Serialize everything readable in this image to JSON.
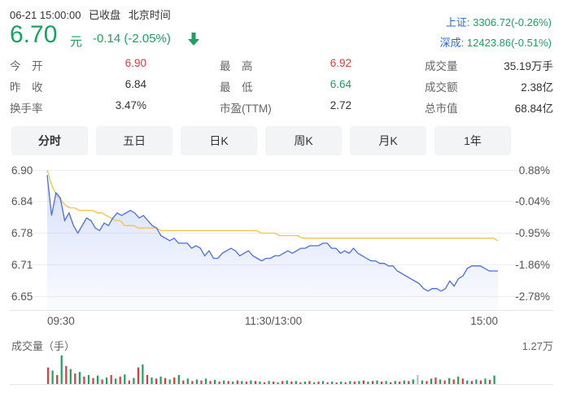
{
  "header": {
    "date": "06-21 15:00:00",
    "status": "已收盘",
    "timezone": "北京时间"
  },
  "quote": {
    "price": "6.70",
    "unit": "元",
    "change": "-0.14 (-2.05%)"
  },
  "indices": [
    {
      "label": "上证:",
      "value": "3306.72(-0.26%)"
    },
    {
      "label": "深成:",
      "value": "12423.86(-0.51%)"
    }
  ],
  "stats": {
    "open_label": "今　开",
    "open": "6.90",
    "high_label": "最　高",
    "high": "6.92",
    "volume_label": "成交量",
    "volume": "35.19万手",
    "prev_label": "昨　收",
    "prev": "6.84",
    "low_label": "最　低",
    "low": "6.64",
    "amount_label": "成交额",
    "amount": "2.38亿",
    "turnover_label": "换手率",
    "turnover": "3.47%",
    "pe_label": "市盈(TTM)",
    "pe": "2.72",
    "mcap_label": "总市值",
    "mcap": "68.84亿"
  },
  "tabs": [
    "分时",
    "五日",
    "日K",
    "周K",
    "月K",
    "1年"
  ],
  "colors": {
    "up": "#e8353a",
    "down": "#1aa261",
    "price_line": "#4a6de5",
    "avg_line": "#f5c24a",
    "index_label": "#2a6ad7"
  },
  "chart_data": {
    "type": "line",
    "price_ticks": [
      "6.90",
      "6.84",
      "6.78",
      "6.71",
      "6.65"
    ],
    "pct_ticks": [
      "0.88%",
      "-0.04%",
      "-0.95%",
      "-1.86%",
      "-2.78%"
    ],
    "time_ticks": [
      "09:30",
      "11:30/13:00",
      "15:00"
    ],
    "ylim": [
      6.65,
      6.9
    ],
    "volume_label": "成交量（手）",
    "volume_max": "1.27万",
    "series": [
      {
        "values": [
          6.89,
          6.81,
          6.855,
          6.845,
          6.8,
          6.815,
          6.79,
          6.775,
          6.79,
          6.805,
          6.8,
          6.785,
          6.78,
          6.795,
          6.79,
          6.805,
          6.815,
          6.81,
          6.815,
          6.82,
          6.815,
          6.805,
          6.81,
          6.8,
          6.79,
          6.785,
          6.77,
          6.765,
          6.76,
          6.765,
          6.755,
          6.755,
          6.755,
          6.745,
          6.75,
          6.745,
          6.73,
          6.74,
          6.725,
          6.725,
          6.735,
          6.74,
          6.745,
          6.74,
          6.73,
          6.735,
          6.74,
          6.73,
          6.725,
          6.72,
          6.725,
          6.725,
          6.73,
          6.73,
          6.735,
          6.74,
          6.735,
          6.74,
          6.745,
          6.745,
          6.75,
          6.75,
          6.75,
          6.755,
          6.755,
          6.745,
          6.745,
          6.735,
          6.74,
          6.735,
          6.745,
          6.735,
          6.73,
          6.725,
          6.72,
          6.72,
          6.715,
          6.715,
          6.71,
          6.71,
          6.7,
          6.695,
          6.69,
          6.685,
          6.68,
          6.675,
          6.665,
          6.66,
          6.665,
          6.665,
          6.66,
          6.665,
          6.68,
          6.67,
          6.685,
          6.69,
          6.705,
          6.71,
          6.71,
          6.71,
          6.705,
          6.7,
          6.7,
          6.7
        ]
      },
      {
        "values": [
          6.9,
          6.87,
          6.85,
          6.84,
          6.83,
          6.825,
          6.825,
          6.82,
          6.82,
          6.82,
          6.82,
          6.815,
          6.815,
          6.81,
          6.805,
          6.8,
          6.8,
          6.79,
          6.79,
          6.79,
          6.785,
          6.785,
          6.785,
          6.785,
          6.785,
          6.78,
          6.78,
          6.78,
          6.78,
          6.78,
          6.78,
          6.78,
          6.78,
          6.78,
          6.78,
          6.78,
          6.78,
          6.78,
          6.78,
          6.78,
          6.78,
          6.78,
          6.78,
          6.78,
          6.78,
          6.78,
          6.78,
          6.775,
          6.775,
          6.775,
          6.775,
          6.77,
          6.77,
          6.77,
          6.77,
          6.77,
          6.765,
          6.765,
          6.765,
          6.765,
          6.765,
          6.765,
          6.765,
          6.765,
          6.765,
          6.765,
          6.765,
          6.765,
          6.765,
          6.765,
          6.765,
          6.765,
          6.765,
          6.765,
          6.765,
          6.765,
          6.765,
          6.765,
          6.765,
          6.765,
          6.765,
          6.765,
          6.765,
          6.765,
          6.765,
          6.765,
          6.765,
          6.765,
          6.765,
          6.765,
          6.765,
          6.765,
          6.765,
          6.765,
          6.765,
          6.765,
          6.765,
          6.765,
          6.765,
          6.76
        ]
      }
    ],
    "volumes": [
      {
        "v": 0.55,
        "c": "up"
      },
      {
        "v": 0.45,
        "c": "down"
      },
      {
        "v": 0.3,
        "c": "up"
      },
      {
        "v": 0.95,
        "c": "down"
      },
      {
        "v": 0.6,
        "c": "up"
      },
      {
        "v": 0.5,
        "c": "down"
      },
      {
        "v": 0.35,
        "c": "up"
      },
      {
        "v": 0.4,
        "c": "down"
      },
      {
        "v": 0.25,
        "c": "up"
      },
      {
        "v": 0.3,
        "c": "down"
      },
      {
        "v": 0.2,
        "c": "up"
      },
      {
        "v": 0.28,
        "c": "down"
      },
      {
        "v": 0.15,
        "c": "up"
      },
      {
        "v": 0.22,
        "c": "down"
      },
      {
        "v": 0.3,
        "c": "up"
      },
      {
        "v": 0.18,
        "c": "down"
      },
      {
        "v": 0.25,
        "c": "up"
      },
      {
        "v": 0.32,
        "c": "down"
      },
      {
        "v": 0.12,
        "c": "up"
      },
      {
        "v": 0.2,
        "c": "down"
      },
      {
        "v": 0.55,
        "c": "up"
      },
      {
        "v": 0.65,
        "c": "down"
      },
      {
        "v": 0.3,
        "c": "up"
      },
      {
        "v": 0.22,
        "c": "down"
      },
      {
        "v": 0.18,
        "c": "up"
      },
      {
        "v": 0.25,
        "c": "down"
      },
      {
        "v": 0.2,
        "c": "up"
      },
      {
        "v": 0.15,
        "c": "down"
      },
      {
        "v": 0.22,
        "c": "up"
      },
      {
        "v": 0.3,
        "c": "down"
      },
      {
        "v": 0.12,
        "c": "up"
      },
      {
        "v": 0.18,
        "c": "down"
      },
      {
        "v": 0.1,
        "c": "up"
      },
      {
        "v": 0.15,
        "c": "down"
      },
      {
        "v": 0.12,
        "c": "up"
      },
      {
        "v": 0.18,
        "c": "down"
      },
      {
        "v": 0.1,
        "c": "up"
      },
      {
        "v": 0.14,
        "c": "down"
      },
      {
        "v": 0.08,
        "c": "up"
      },
      {
        "v": 0.12,
        "c": "down"
      },
      {
        "v": 0.1,
        "c": "up"
      },
      {
        "v": 0.08,
        "c": "down"
      },
      {
        "v": 0.12,
        "c": "up"
      },
      {
        "v": 0.1,
        "c": "down"
      },
      {
        "v": 0.08,
        "c": "up"
      },
      {
        "v": 0.12,
        "c": "down"
      },
      {
        "v": 0.1,
        "c": "up"
      },
      {
        "v": 0.08,
        "c": "down"
      },
      {
        "v": 0.06,
        "c": "up"
      },
      {
        "v": 0.1,
        "c": "down"
      },
      {
        "v": 0.08,
        "c": "up"
      },
      {
        "v": 0.06,
        "c": "down"
      },
      {
        "v": 0.1,
        "c": "up"
      },
      {
        "v": 0.12,
        "c": "down"
      },
      {
        "v": 0.08,
        "c": "up"
      },
      {
        "v": 0.1,
        "c": "down"
      },
      {
        "v": 0.06,
        "c": "up"
      },
      {
        "v": 0.08,
        "c": "down"
      },
      {
        "v": 0.1,
        "c": "up"
      },
      {
        "v": 0.06,
        "c": "down"
      },
      {
        "v": 0.08,
        "c": "up"
      },
      {
        "v": 0.1,
        "c": "down"
      },
      {
        "v": 0.06,
        "c": "up"
      },
      {
        "v": 0.08,
        "c": "down"
      },
      {
        "v": 0.05,
        "c": "up"
      },
      {
        "v": 0.08,
        "c": "down"
      },
      {
        "v": 0.06,
        "c": "up"
      },
      {
        "v": 0.1,
        "c": "down"
      },
      {
        "v": 0.08,
        "c": "up"
      },
      {
        "v": 0.1,
        "c": "down"
      },
      {
        "v": 0.12,
        "c": "up"
      },
      {
        "v": 0.08,
        "c": "down"
      },
      {
        "v": 0.1,
        "c": "up"
      },
      {
        "v": 0.12,
        "c": "down"
      },
      {
        "v": 0.08,
        "c": "up"
      },
      {
        "v": 0.1,
        "c": "down"
      },
      {
        "v": 0.06,
        "c": "up"
      },
      {
        "v": 0.1,
        "c": "down"
      },
      {
        "v": 0.08,
        "c": "up"
      },
      {
        "v": 0.12,
        "c": "down"
      },
      {
        "v": 0.1,
        "c": "up"
      },
      {
        "v": 0.15,
        "c": "down"
      },
      {
        "v": 0.3,
        "c": "flat"
      },
      {
        "v": 0.12,
        "c": "down"
      },
      {
        "v": 0.1,
        "c": "up"
      },
      {
        "v": 0.18,
        "c": "down"
      },
      {
        "v": 0.22,
        "c": "up"
      },
      {
        "v": 0.15,
        "c": "down"
      },
      {
        "v": 0.12,
        "c": "up"
      },
      {
        "v": 0.2,
        "c": "down"
      },
      {
        "v": 0.15,
        "c": "up"
      },
      {
        "v": 0.25,
        "c": "down"
      },
      {
        "v": 0.18,
        "c": "up"
      },
      {
        "v": 0.12,
        "c": "down"
      },
      {
        "v": 0.1,
        "c": "up"
      },
      {
        "v": 0.15,
        "c": "down"
      },
      {
        "v": 0.12,
        "c": "up"
      },
      {
        "v": 0.18,
        "c": "down"
      },
      {
        "v": 0.14,
        "c": "up"
      },
      {
        "v": 0.28,
        "c": "down"
      }
    ]
  }
}
